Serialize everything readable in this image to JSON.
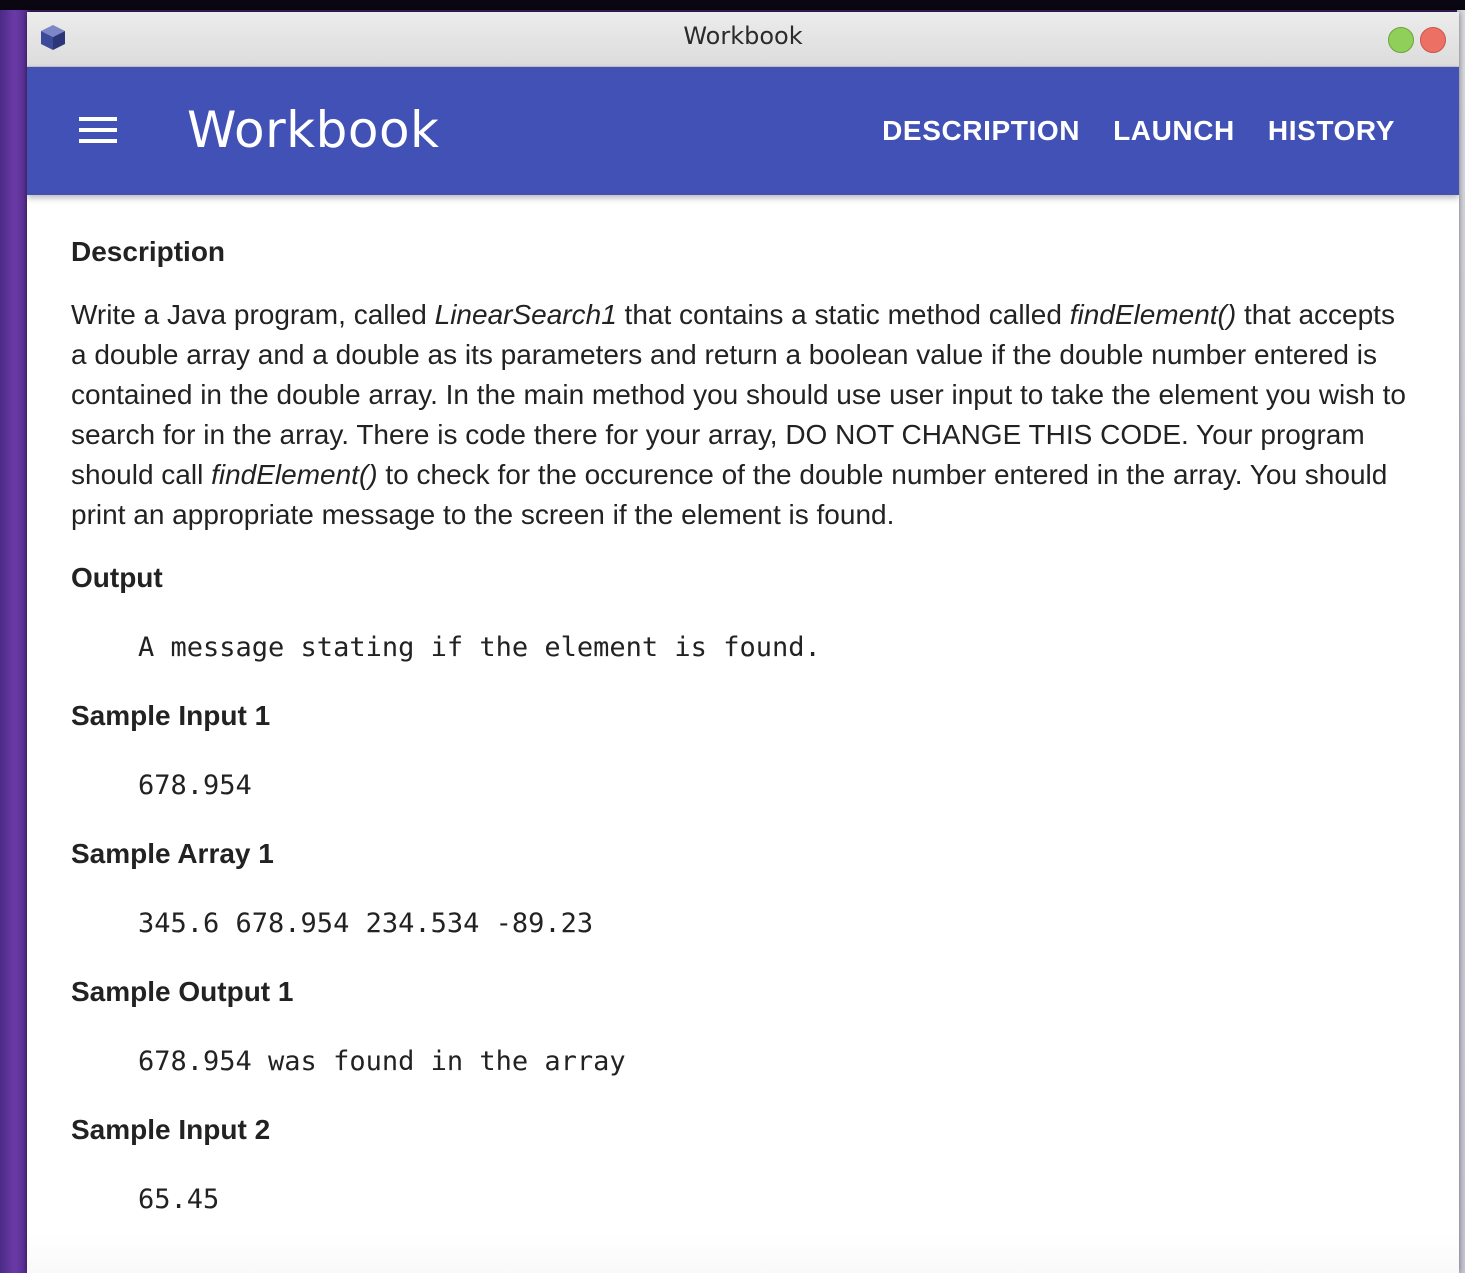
{
  "window": {
    "title": "Workbook"
  },
  "appbar": {
    "title": "Workbook",
    "nav": [
      {
        "label": "DESCRIPTION"
      },
      {
        "label": "LAUNCH"
      },
      {
        "label": "HISTORY"
      }
    ]
  },
  "content": {
    "description_heading": "Description",
    "description": {
      "t1": "Write a Java program, called ",
      "class_name": "LinearSearch1",
      "t2": " that contains a static method called ",
      "method1": "findElement()",
      "t3": " that accepts a double array and a double as its parameters and return a boolean value if the double number entered is contained in the double array. In the main method you should use user input to take the element you wish to search for in the array. There is code there for your array, DO NOT CHANGE THIS CODE. Your program should call ",
      "method2": "findElement()",
      "t4": " to check for the occurence of the double number entered in the array. You should print an appropriate message to the screen if the element is found."
    },
    "output_heading": "Output",
    "output_text": "A message stating if the element is found.",
    "sample_input1_heading": "Sample Input 1",
    "sample_input1": "678.954",
    "sample_array1_heading": "Sample Array 1",
    "sample_array1": "345.6 678.954 234.534 -89.23",
    "sample_output1_heading": "Sample Output 1",
    "sample_output1": "678.954 was found in the array",
    "sample_input2_heading": "Sample Input 2",
    "sample_input2": "65.45"
  },
  "colors": {
    "appbar": "#4151b5",
    "close_button": "#ec7064",
    "maximize_button": "#8fcf5a"
  },
  "icons": {
    "app": "cube-icon",
    "menu": "hamburger-menu-icon"
  }
}
